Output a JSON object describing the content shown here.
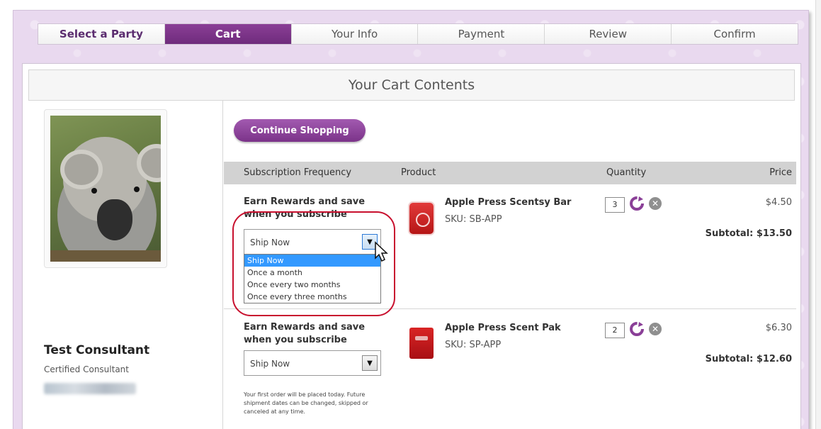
{
  "steps": [
    {
      "label": "Select a Party"
    },
    {
      "label": "Cart"
    },
    {
      "label": "Your Info"
    },
    {
      "label": "Payment"
    },
    {
      "label": "Review"
    },
    {
      "label": "Confirm"
    }
  ],
  "active_step": "Cart",
  "panel_title": "Your Cart Contents",
  "consultant": {
    "name": "Test Consultant",
    "title": "Certified Consultant"
  },
  "continue_label": "Continue Shopping",
  "table": {
    "headers": {
      "frequency": "Subscription Frequency",
      "product": "Product",
      "quantity": "Quantity",
      "price": "Price"
    }
  },
  "items": [
    {
      "earn_text": "Earn Rewards and save when you subscribe",
      "frequency_value": "Ship Now",
      "name": "Apple Press Scentsy Bar",
      "sku": "SKU: SB-APP",
      "quantity": "3",
      "price": "$4.50",
      "subtotal": "Subtotal: $13.50"
    },
    {
      "earn_text": "Earn Rewards and save when you subscribe",
      "frequency_value": "Ship Now",
      "name": "Apple Press Scent Pak",
      "sku": "SKU: SP-APP",
      "quantity": "2",
      "price": "$6.30",
      "subtotal": "Subtotal: $12.60",
      "note": "Your first order will be placed today. Future shipment dates can be changed, skipped or canceled at any time."
    }
  ],
  "frequency_options": [
    "Ship Now",
    "Once a month",
    "Once every two months",
    "Once every three months"
  ],
  "colors": {
    "brand_purple": "#6e2b7c",
    "button_purple": "#8d44a0",
    "page_lavender": "#e9d9ef",
    "highlight_red": "#c8102e",
    "dropdown_selected": "#3399ff"
  },
  "icons": {
    "refresh": "refresh-icon",
    "remove": "remove-icon",
    "dropdown": "chevron-down-icon",
    "cursor": "mouse-pointer-icon"
  }
}
